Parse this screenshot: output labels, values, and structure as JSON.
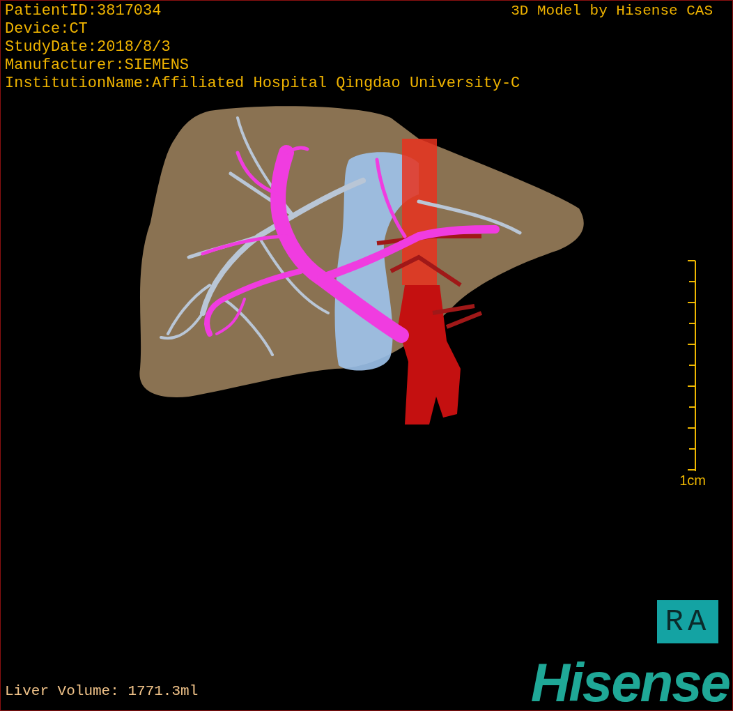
{
  "overlay": {
    "patient_info": [
      "PatientID:3817034",
      "Device:CT",
      "StudyDate:2018/8/3",
      "Manufacturer:SIEMENS",
      "InstitutionName:Affiliated Hospital Qingdao University-C"
    ],
    "title": "3D Model by Hisense CAS"
  },
  "scale_bar": {
    "label": "1cm"
  },
  "orientation_label": "RA",
  "liver_volume": "Liver Volume: 1771.3ml",
  "logo": "Hisense"
}
